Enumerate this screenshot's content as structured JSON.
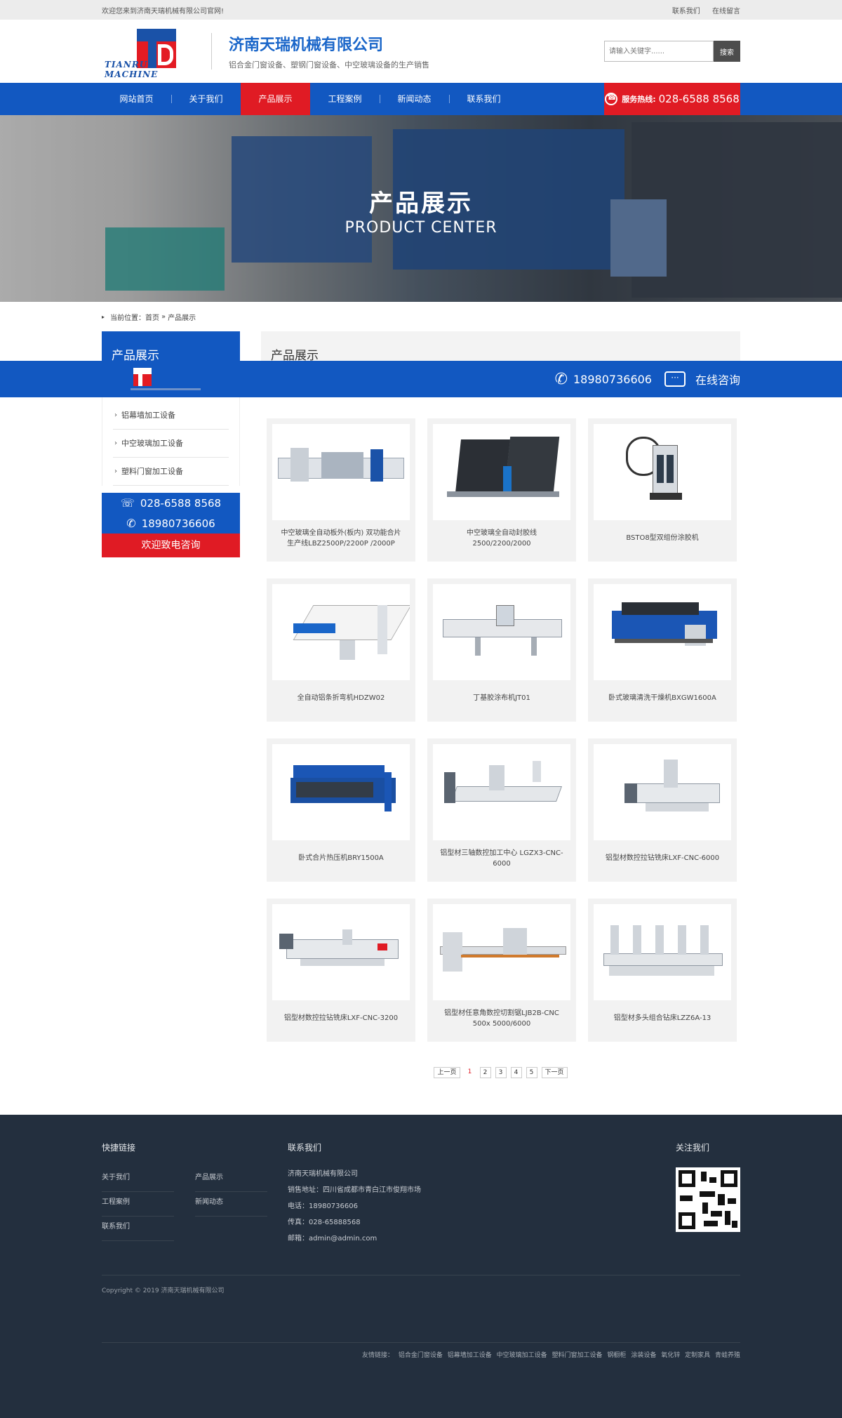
{
  "topbar": {
    "welcome": "欢迎您来到济南天瑞机械有限公司官网!",
    "links": [
      "联系我们",
      "在线留言"
    ]
  },
  "header": {
    "logo_en": "TIANRUI MACHINE",
    "company": "济南天瑞机械有限公司",
    "tagline": "铝合金门窗设备、塑钢门窗设备、中空玻璃设备的生产销售",
    "search_placeholder": "请输入关键字......",
    "search_button": "搜索"
  },
  "nav": {
    "items": [
      "网站首页",
      "关于我们",
      "产品展示",
      "工程案例",
      "新闻动态",
      "联系我们"
    ],
    "active_index": 2,
    "hotline_label": "服务热线:",
    "hotline_number": "028-6588 8568"
  },
  "banner": {
    "title_cn": "产品展示",
    "title_en": "PRODUCT CENTER"
  },
  "breadcrumb": {
    "prefix": "当前位置：",
    "home": "首页",
    "sep": "»",
    "current": "产品展示"
  },
  "sidebar": {
    "title": "产品展示",
    "items": [
      "铝幕墙加工设备",
      "中空玻璃加工设备",
      "塑料门窗加工设备"
    ],
    "phone1": "028-6588 8568",
    "phone2": "18980736606",
    "cta": "欢迎致电咨询"
  },
  "content": {
    "title": "产品展示",
    "products": [
      {
        "name": "中空玻璃全自动板外(板内) 双功能合片生产线LBZ2500P/2200P /2000P"
      },
      {
        "name": "中空玻璃全自动封胶线2500/2200/2000"
      },
      {
        "name": "BSTO8型双组份涂胶机"
      },
      {
        "name": "全自动铝条折弯机HDZW02"
      },
      {
        "name": "丁基胶涂布机JT01"
      },
      {
        "name": "卧式玻璃清洗干燥机BXGW1600A"
      },
      {
        "name": "卧式合片热压机BRY1500A"
      },
      {
        "name": "铝型材三轴数控加工中心 LGZX3-CNC-6000"
      },
      {
        "name": "铝型材数控拉钻铣床LXF-CNC-6000"
      },
      {
        "name": "铝型材数控拉钻铣床LXF-CNC-3200"
      },
      {
        "name": "铝型材任意角数控切割锯LJB2B-CNC 500x 5000/6000"
      },
      {
        "name": "铝型材多头组合钻床LZZ6A-13"
      }
    ],
    "pager": {
      "prev": "上一页",
      "pages": [
        "1",
        "2",
        "3",
        "4",
        "5"
      ],
      "current": "1",
      "next": "下一页"
    }
  },
  "floatbar": {
    "phone": "18980736606",
    "consult": "在线咨询"
  },
  "footer": {
    "quick_title": "快捷链接",
    "quick_links": [
      "关于我们",
      "产品展示",
      "工程案例",
      "新闻动态",
      "联系我们"
    ],
    "contact_title": "联系我们",
    "contact_lines": [
      "济南天瑞机械有限公司",
      "销售地址：四川省成都市青白江市俊翔市场",
      "电话：18980736606",
      "传真：028-65888568",
      "邮箱：admin@admin.com"
    ],
    "follow_title": "关注我们",
    "copyright": "Copyright © 2019 济南天瑞机械有限公司",
    "friend_label": "友情链接：",
    "friend_links": [
      "铝合金门窗设备",
      "铝幕墙加工设备",
      "中空玻璃加工设备",
      "塑料门窗加工设备",
      "钢橱柜",
      "涂装设备",
      "氧化锌",
      "定制家具",
      "青蛙养殖"
    ]
  }
}
